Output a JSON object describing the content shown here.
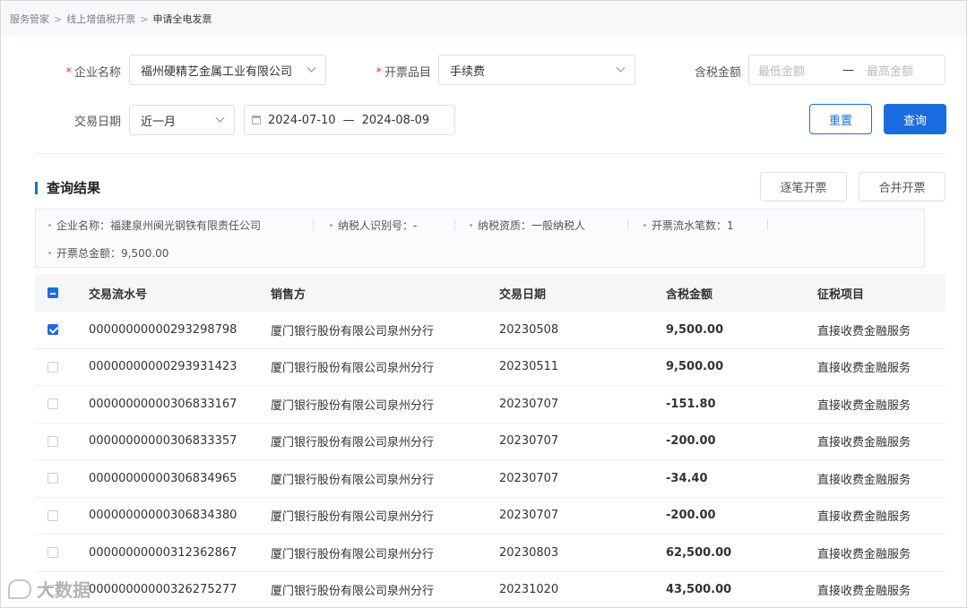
{
  "breadcrumb": {
    "items": [
      "服务管家",
      "线上增值税开票",
      "申请全电发票"
    ],
    "separator": ">"
  },
  "form": {
    "company": {
      "label": "企业名称",
      "value": "福州硬精艺金属工业有限公司"
    },
    "category": {
      "label": "开票品目",
      "value": "手续费"
    },
    "amount": {
      "label": "含税金额",
      "min_placeholder": "最低金额",
      "dash": "—",
      "max_placeholder": "最高金额"
    },
    "date": {
      "label": "交易日期",
      "range_option": "近一月",
      "start": "2024-07-10",
      "dash": "—",
      "end": "2024-08-09"
    },
    "reset_label": "重置",
    "search_label": "查询"
  },
  "results": {
    "title": "查询结果",
    "btn_single": "逐笔开票",
    "btn_merge": "合并开票",
    "summary": {
      "company": "企业名称：福建泉州闽光钢铁有限责任公司",
      "taxpayer_id": "纳税人识别号：-",
      "qualification": "纳税资质：一般纳税人",
      "count": "开票流水笔数：1",
      "total": "开票总金额：9,500.00"
    }
  },
  "table": {
    "headers": [
      "交易流水号",
      "销售方",
      "交易日期",
      "含税金额",
      "征税项目"
    ],
    "rows": [
      {
        "checked": true,
        "serial": "00000000000293298798",
        "seller": "厦门银行股份有限公司泉州分行",
        "date": "20230508",
        "amount": "9,500.00",
        "tax_item": "直接收费金融服务"
      },
      {
        "checked": false,
        "serial": "00000000000293931423",
        "seller": "厦门银行股份有限公司泉州分行",
        "date": "20230511",
        "amount": "9,500.00",
        "tax_item": "直接收费金融服务"
      },
      {
        "checked": false,
        "serial": "00000000000306833167",
        "seller": "厦门银行股份有限公司泉州分行",
        "date": "20230707",
        "amount": "-151.80",
        "tax_item": "直接收费金融服务"
      },
      {
        "checked": false,
        "serial": "00000000000306833357",
        "seller": "厦门银行股份有限公司泉州分行",
        "date": "20230707",
        "amount": "-200.00",
        "tax_item": "直接收费金融服务"
      },
      {
        "checked": false,
        "serial": "00000000000306834965",
        "seller": "厦门银行股份有限公司泉州分行",
        "date": "20230707",
        "amount": "-34.40",
        "tax_item": "直接收费金融服务"
      },
      {
        "checked": false,
        "serial": "00000000000306834380",
        "seller": "厦门银行股份有限公司泉州分行",
        "date": "20230707",
        "amount": "-200.00",
        "tax_item": "直接收费金融服务"
      },
      {
        "checked": false,
        "serial": "00000000000312362867",
        "seller": "厦门银行股份有限公司泉州分行",
        "date": "20230803",
        "amount": "62,500.00",
        "tax_item": "直接收费金融服务"
      },
      {
        "checked": false,
        "serial": "00000000000326275277",
        "seller": "厦门银行股份有限公司泉州分行",
        "date": "20231020",
        "amount": "43,500.00",
        "tax_item": "直接收费金融服务"
      }
    ]
  },
  "watermark": {
    "text": "大数据"
  },
  "colors": {
    "primary": "#1a6de0",
    "required": "#e53935"
  }
}
